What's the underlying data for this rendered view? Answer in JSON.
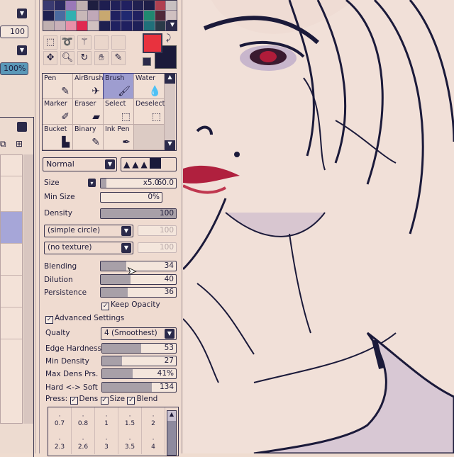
{
  "left_panel": {
    "value1": "100",
    "value2": "100%"
  },
  "palette": {
    "colors": [
      "#3a3a70",
      "#2a2a60",
      "#9a78b8",
      "#c0b0b0",
      "#1e1e40",
      "#1e1e50",
      "#202058",
      "#202060",
      "#202050",
      "#1e1e48",
      "#b04050",
      "#c8c0c0",
      "#1e2050",
      "#4a6aa0",
      "#30b0b0",
      "#c8b8b8",
      "#c0a8b8",
      "#c8a870",
      "#202060",
      "#202870",
      "#202060",
      "#208870",
      "#502838",
      "#d0c0c0",
      "#c0b0b0",
      "#c8b0b8",
      "#e890a8",
      "#e02850",
      "#d0c0c0",
      "#1e2050",
      "#202060",
      "#202060",
      "#1e2058",
      "#20707a",
      "#2a3a48",
      "#2a2a50"
    ]
  },
  "tools": {
    "selection": [
      "select-rect",
      "lasso",
      "magic-wand",
      "",
      "",
      "move",
      "zoom",
      "rotate",
      "hand",
      "eyedropper"
    ],
    "primary_color": "#e8323e",
    "secondary_color": "#1b1a3a"
  },
  "brushes": [
    {
      "label": "Pen",
      "icon": "✎"
    },
    {
      "label": "AirBrush",
      "icon": "✈"
    },
    {
      "label": "Brush",
      "icon": "🖌",
      "selected": true
    },
    {
      "label": "Water",
      "icon": "💧"
    },
    {
      "label": "Marker",
      "icon": "✐"
    },
    {
      "label": "Eraser",
      "icon": "▰"
    },
    {
      "label": "Select",
      "icon": "⬚"
    },
    {
      "label": "Deselect",
      "icon": "⬚"
    },
    {
      "label": "Bucket",
      "icon": "▙"
    },
    {
      "label": "Binary",
      "icon": "✎"
    },
    {
      "label": "Ink Pen",
      "icon": "✒"
    },
    {
      "label": "",
      "icon": ""
    }
  ],
  "blend_mode": "Normal",
  "settings": {
    "size_label": "Size",
    "size_mult": "x5.0",
    "size_value": "60.0",
    "min_size_label": "Min Size",
    "min_size_value": "0%",
    "density_label": "Density",
    "density_value": "100",
    "shape": "(simple circle)",
    "shape_value": "100",
    "texture": "(no texture)",
    "texture_value": "100",
    "blending_label": "Blending",
    "blending_value": "34",
    "dilution_label": "Dilution",
    "dilution_value": "40",
    "persistence_label": "Persistence",
    "persistence_value": "36",
    "keep_opacity": "Keep Opacity",
    "advanced": "Advanced Settings",
    "quality_label": "Qualty",
    "quality_value": "4 (Smoothest)",
    "edge_label": "Edge Hardness",
    "edge_value": "53",
    "min_density_label": "Min Density",
    "min_density_value": "27",
    "max_dens_label": "Max Dens Prs.",
    "max_dens_value": "41%",
    "hard_soft_label": "Hard <-> Soft",
    "hard_soft_value": "134",
    "press_label": "Press:",
    "press_dens": "Dens",
    "press_size": "Size",
    "press_blend": "Blend"
  },
  "brush_sizes": [
    "0.7",
    "0.8",
    "1",
    "1.5",
    "2",
    "2.3",
    "2.6",
    "3",
    "3.5",
    "4"
  ]
}
